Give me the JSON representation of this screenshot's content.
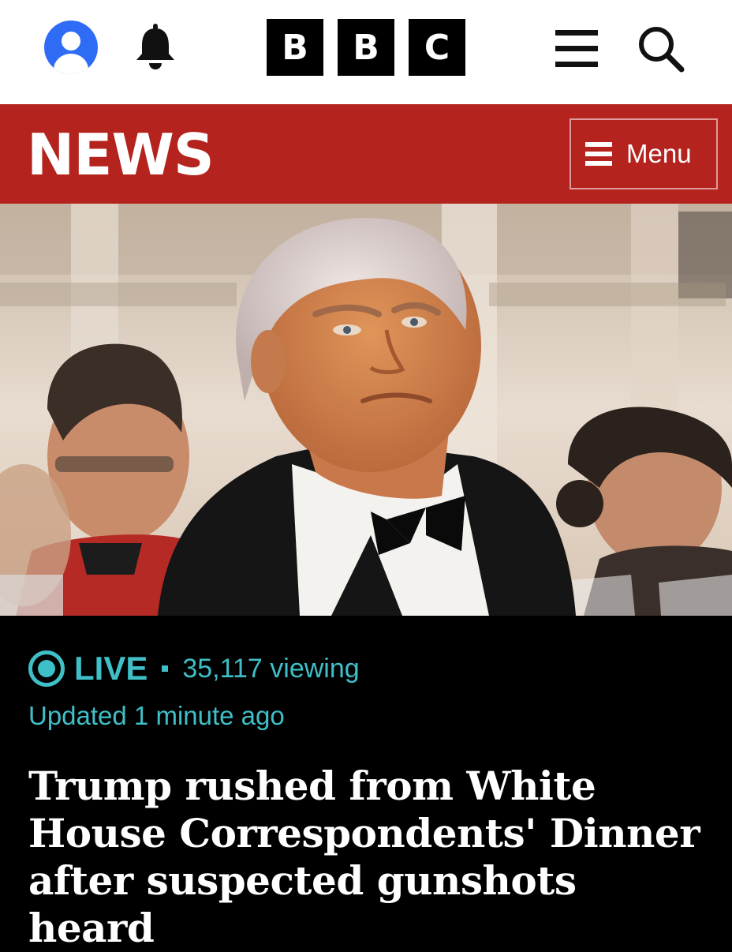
{
  "header": {
    "account_icon": "account-icon",
    "notifications_icon": "bell-icon",
    "logo": [
      "B",
      "B",
      "C"
    ],
    "hamburger_icon": "hamburger-icon",
    "search_icon": "search-icon"
  },
  "section": {
    "title": "NEWS",
    "menu_label": "Menu",
    "menu_icon": "menu-icon",
    "color": "#b5231e"
  },
  "hero_image": {
    "alt": ""
  },
  "article": {
    "live_label": "LIVE",
    "viewers": "35,117 viewing",
    "updated": "Updated 1 minute ago",
    "headline": "Trump rushed from White House Correspondents' Dinner after suspected gunshots heard",
    "accent_color": "#3fbfc7"
  }
}
